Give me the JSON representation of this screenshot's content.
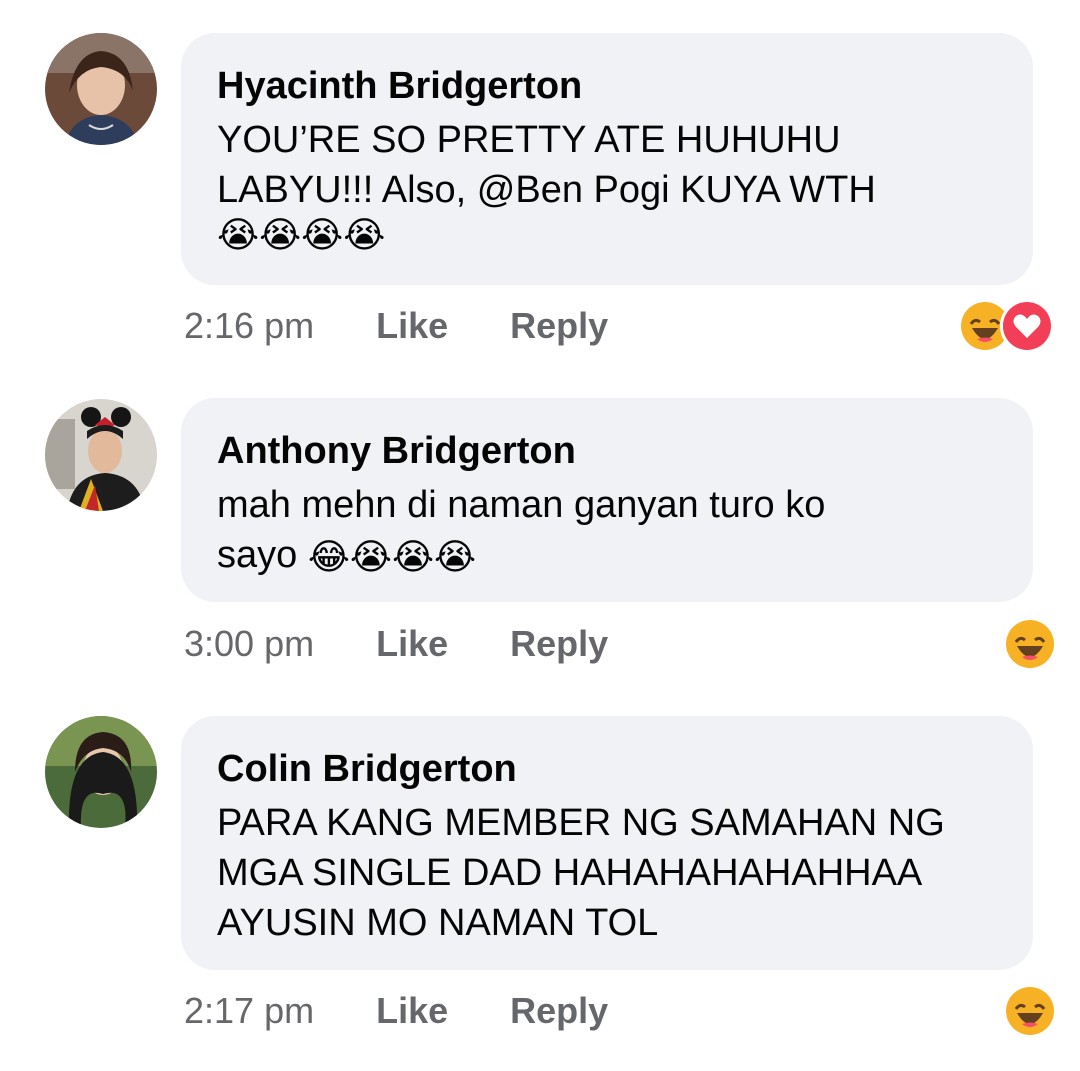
{
  "comments": [
    {
      "author": "Hyacinth Bridgerton",
      "text": "YOU’RE SO PRETTY ATE HUHUHU\nLABYU!!! Also, @Ben Pogi KUYA WTH",
      "emoji_line": "😭😭😭😭",
      "time": "2:16 pm",
      "like_label": "Like",
      "reply_label": "Reply",
      "reactions": [
        "haha-icon",
        "love-icon"
      ]
    },
    {
      "author": "Anthony Bridgerton",
      "text": "mah mehn di naman ganyan turo ko\nsayo",
      "emoji_line": "😂😭😭😭",
      "time": "3:00 pm",
      "like_label": "Like",
      "reply_label": "Reply",
      "reactions": [
        "haha-icon"
      ]
    },
    {
      "author": "Colin Bridgerton",
      "text": "PARA KANG MEMBER NG SAMAHAN NG\nMGA SINGLE DAD HAHAHAHAHAHHAA\nAYUSIN MO NAMAN TOL",
      "emoji_line": "",
      "time": "2:17 pm",
      "like_label": "Like",
      "reply_label": "Reply",
      "reactions": [
        "haha-icon"
      ]
    }
  ],
  "colors": {
    "bubble": "#f0f2f5",
    "meta": "#65676b",
    "text": "#050505",
    "haha": "#f7b125",
    "love": "#f33e58"
  }
}
